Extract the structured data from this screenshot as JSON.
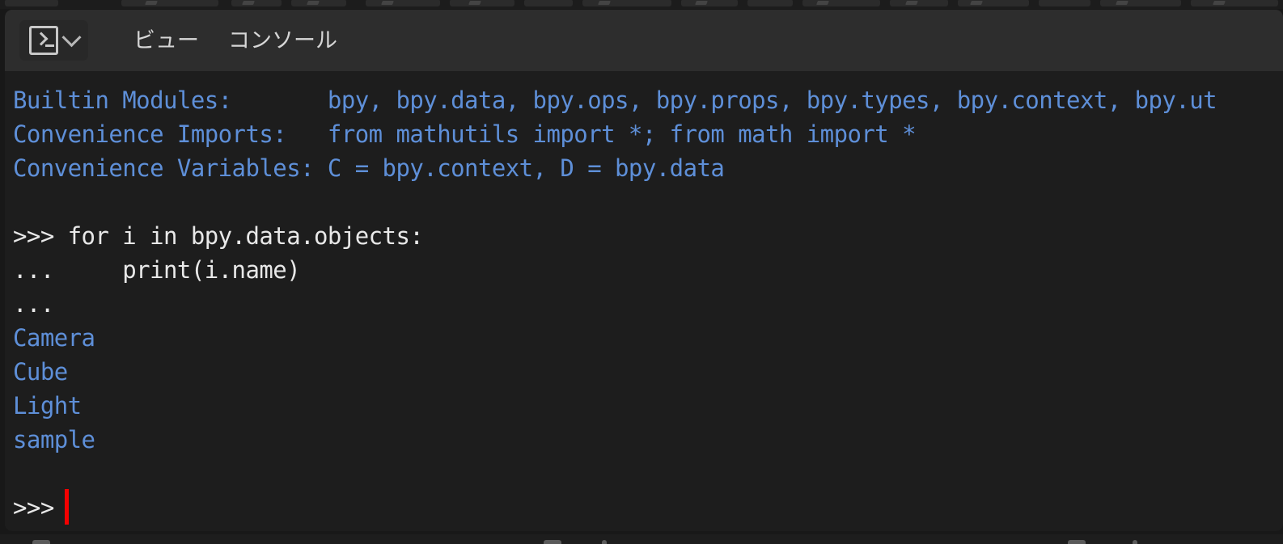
{
  "window": {
    "background_color": "#181818",
    "editor_background": "#1d1d1d",
    "header_background": "#2d2d2d"
  },
  "header": {
    "editor_type": {
      "name": "Python Console",
      "icon": "console-icon",
      "dropdown_icon": "chevron-down-icon"
    },
    "menus": [
      {
        "label": "ビュー"
      },
      {
        "label": "コンソール"
      }
    ]
  },
  "console": {
    "text_color_info": "#5e8fd8",
    "text_color_prompt": "#e8e8e8",
    "cursor_color": "#f50000",
    "lines": [
      {
        "kind": "info",
        "text": "Builtin Modules:       bpy, bpy.data, bpy.ops, bpy.props, bpy.types, bpy.context, bpy.ut"
      },
      {
        "kind": "info",
        "text": "Convenience Imports:   from mathutils import *; from math import *"
      },
      {
        "kind": "info",
        "text": "Convenience Variables: C = bpy.context, D = bpy.data"
      },
      {
        "kind": "blank",
        "text": ""
      },
      {
        "kind": "prompt",
        "text": ">>> for i in bpy.data.objects:"
      },
      {
        "kind": "prompt",
        "text": "...     print(i.name)"
      },
      {
        "kind": "prompt",
        "text": "... "
      },
      {
        "kind": "output",
        "text": "Camera"
      },
      {
        "kind": "output",
        "text": "Cube"
      },
      {
        "kind": "output",
        "text": "Light"
      },
      {
        "kind": "output",
        "text": "sample"
      },
      {
        "kind": "blank",
        "text": ""
      },
      {
        "kind": "prompt",
        "text": ">>> "
      }
    ],
    "prompt_symbol": ">>>",
    "continuation_symbol": "..."
  }
}
